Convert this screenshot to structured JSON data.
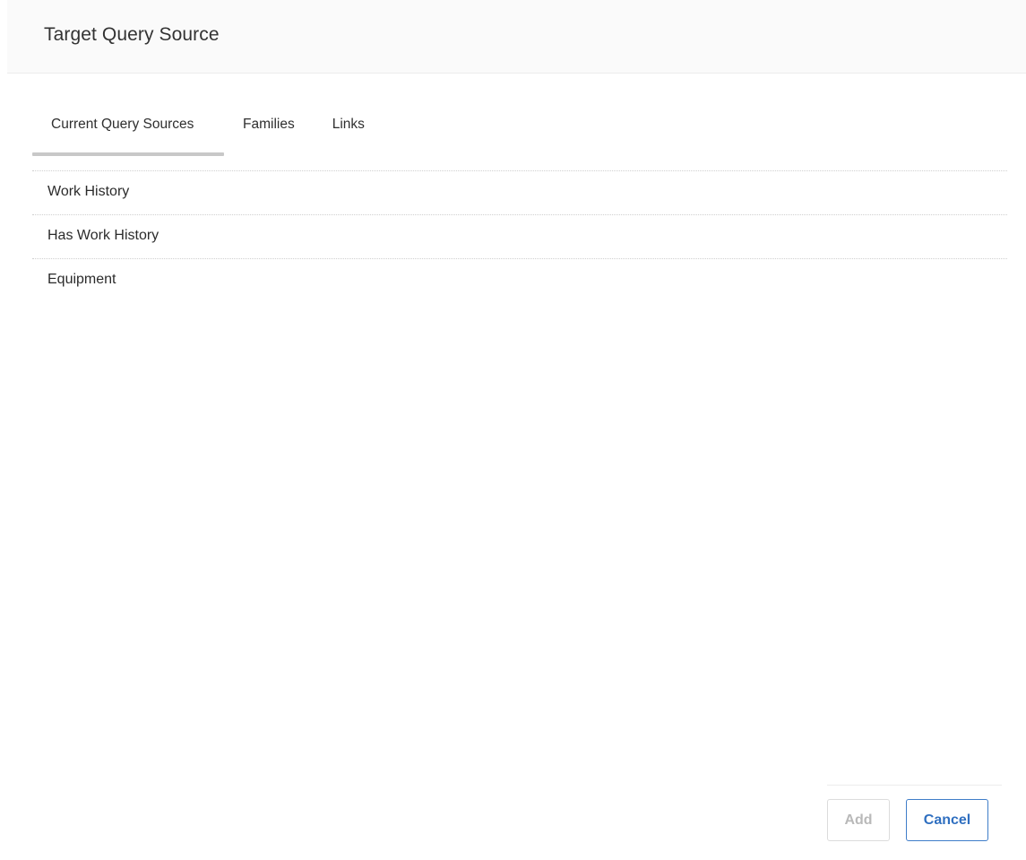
{
  "dialog": {
    "title": "Target Query Source"
  },
  "tabs": [
    {
      "label": "Current Query Sources",
      "active": true
    },
    {
      "label": "Families",
      "active": false
    },
    {
      "label": "Links",
      "active": false
    }
  ],
  "list": {
    "items": [
      {
        "label": "Work History"
      },
      {
        "label": "Has Work History"
      },
      {
        "label": "Equipment"
      }
    ]
  },
  "footer": {
    "add_label": "Add",
    "add_disabled": true,
    "cancel_label": "Cancel"
  },
  "colors": {
    "accent": "#2f6fc0",
    "tab_indicator": "#c8c8c8",
    "disabled_text": "#b9b9b9"
  }
}
